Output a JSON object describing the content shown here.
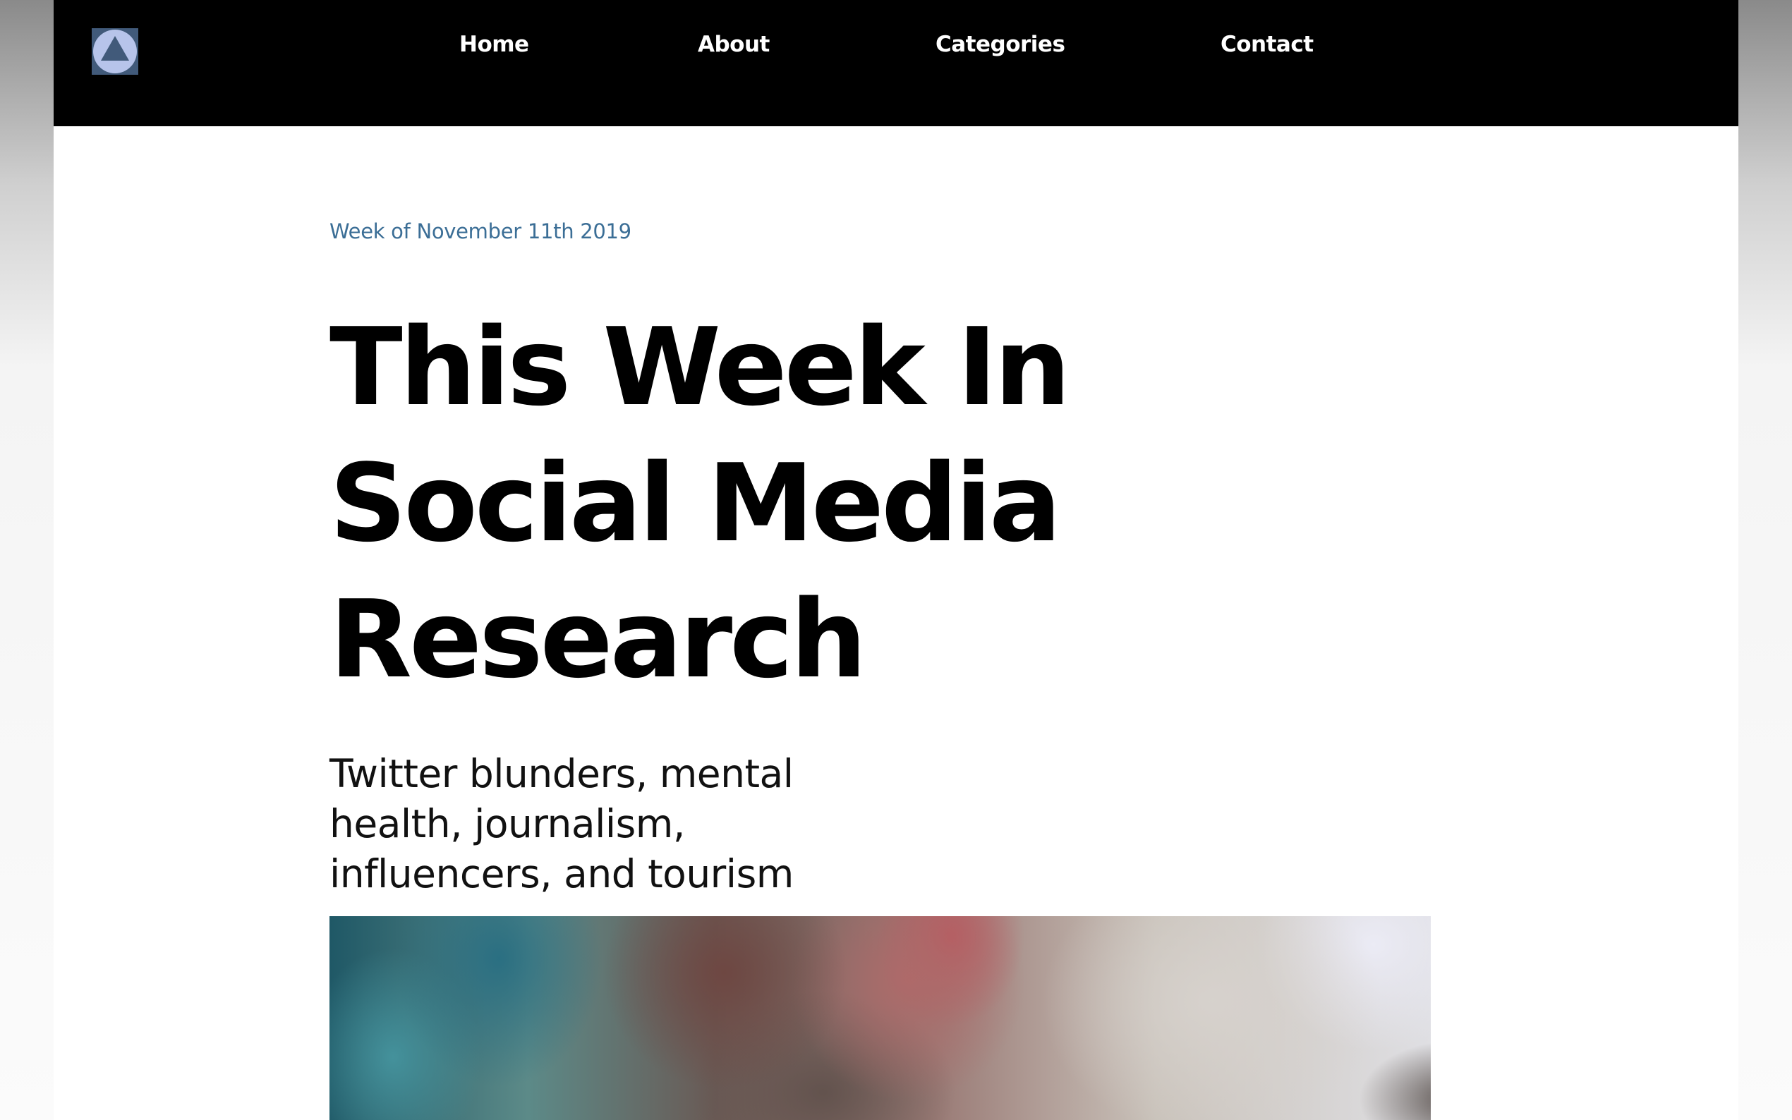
{
  "nav": {
    "logo_icon": "triangle-in-circle-icon",
    "items": [
      {
        "label": "Home"
      },
      {
        "label": "About"
      },
      {
        "label": "Categories"
      },
      {
        "label": "Contact"
      }
    ]
  },
  "article": {
    "date": "Week of November 11th 2019",
    "title_lines": [
      "This Week In",
      "Social Media",
      "Research"
    ],
    "subtitle_lines": [
      "Twitter blunders, mental",
      "health, journalism,",
      "influencers, and tourism"
    ]
  },
  "colors": {
    "topbar": "#000000",
    "date_text": "#3b6e96",
    "logo_background": "#415a7a",
    "logo_circle": "#b7c4ea"
  }
}
